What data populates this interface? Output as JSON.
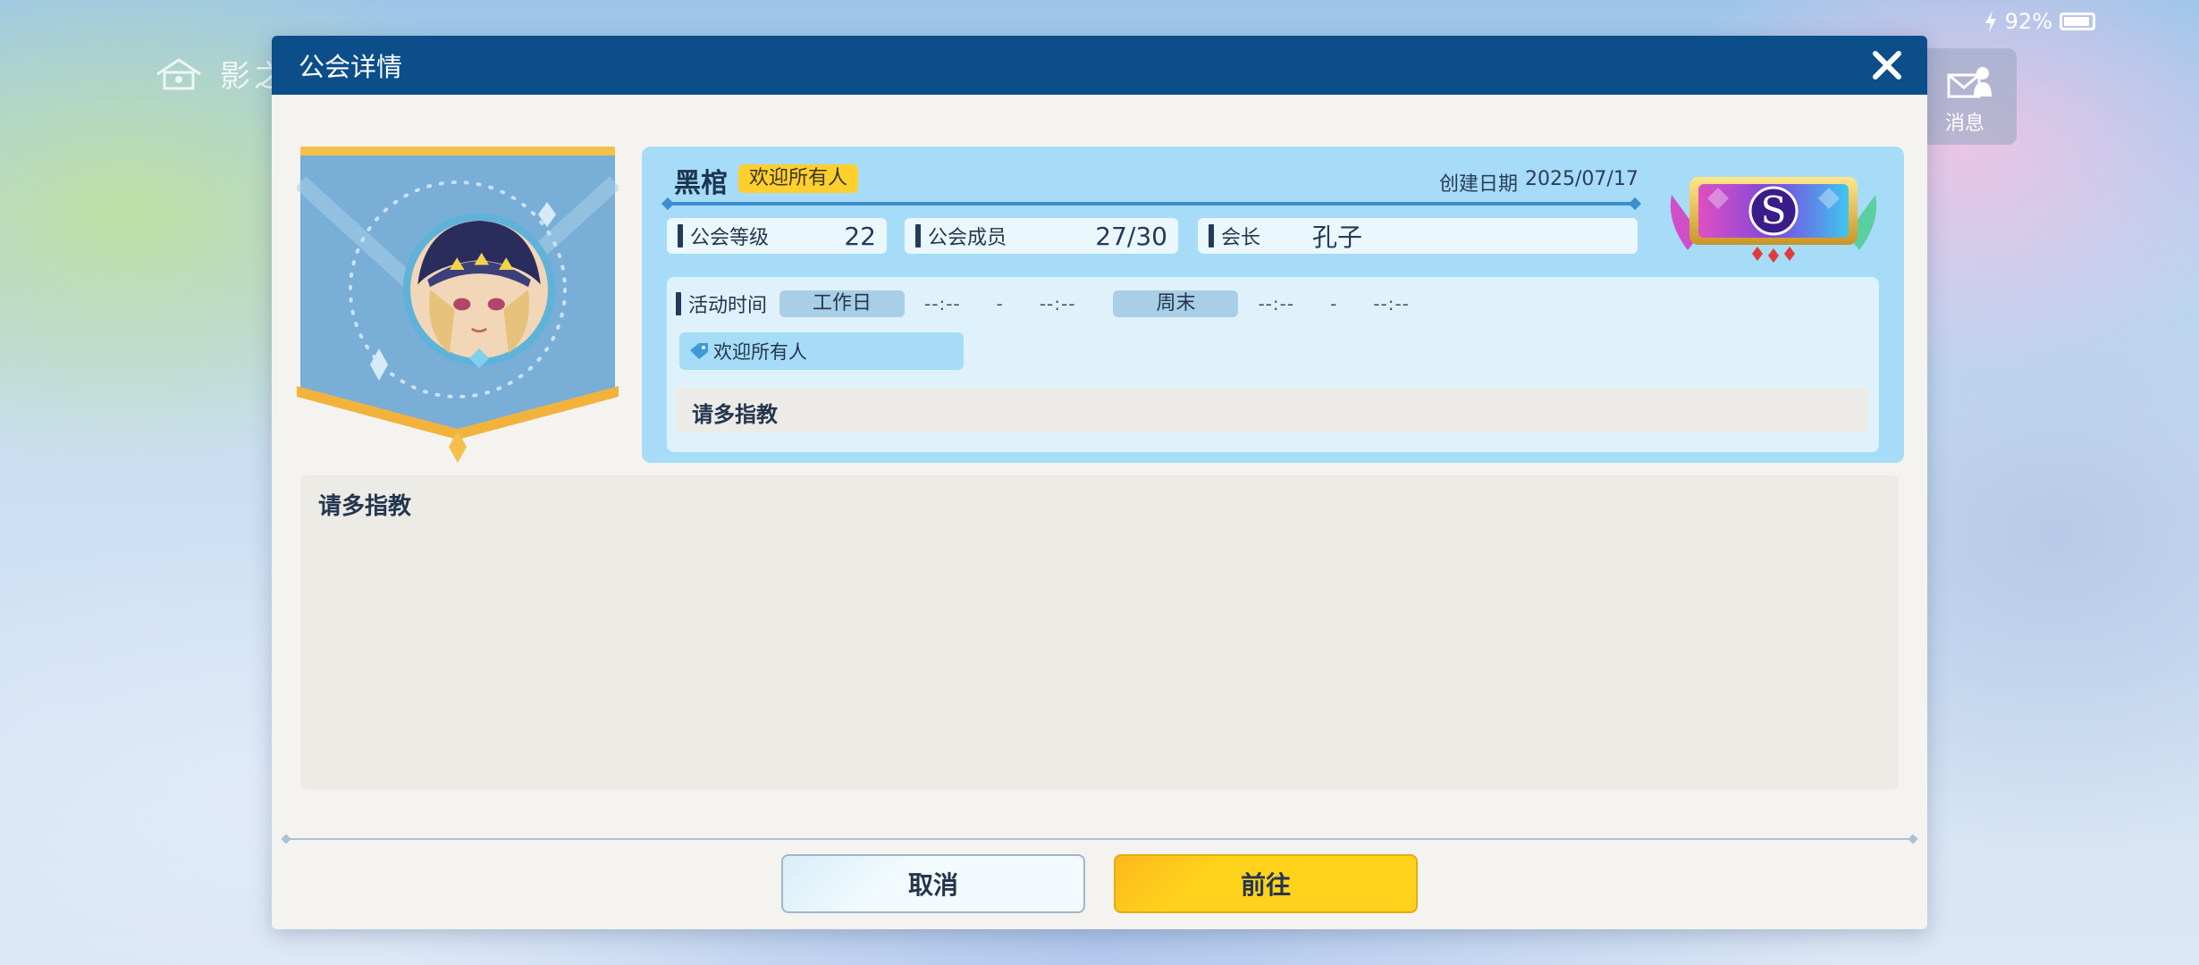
{
  "background": {
    "home_label": "影之",
    "battery_percent": "92%",
    "messages_label": "消息"
  },
  "dialog": {
    "title": "公会详情",
    "guild": {
      "name": "黑棺",
      "name_tag": "欢迎所有人",
      "created_label": "创建日期",
      "created_date": "2025/07/17",
      "rank": "S"
    },
    "stats": {
      "level_label": "公会等级",
      "level_value": "22",
      "members_label": "公会成员",
      "members_value": "27/30",
      "leader_label": "会长",
      "leader_value": "孔子"
    },
    "activity": {
      "label": "活动时间",
      "weekday_label": "工作日",
      "weekday_start": "--:--",
      "weekday_sep": "-",
      "weekday_end": "--:--",
      "weekend_label": "周末",
      "weekend_start": "--:--",
      "weekend_sep": "-",
      "weekend_end": "--:--",
      "tag": "欢迎所有人",
      "short_description": "请多指教"
    },
    "description": "请多指教",
    "buttons": {
      "cancel": "取消",
      "go": "前往"
    }
  },
  "colors": {
    "header": "#0b4e8a",
    "panel": "#a6dcf7",
    "accent_yellow": "#ffd21c"
  }
}
